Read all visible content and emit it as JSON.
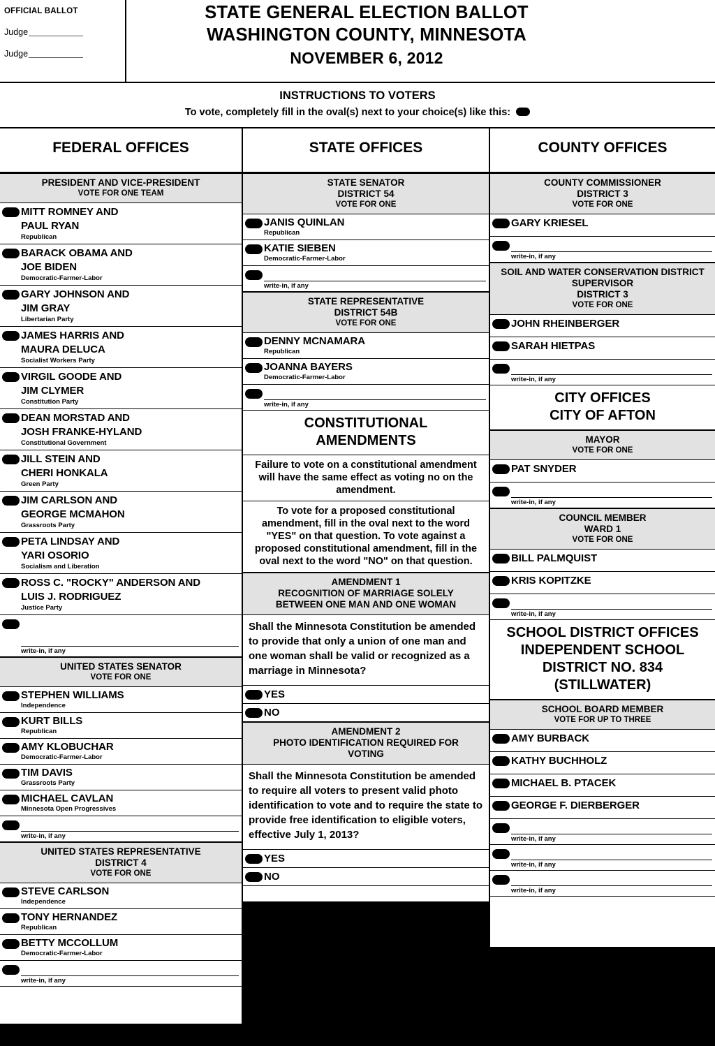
{
  "header": {
    "official_ballot": "OFFICIAL BALLOT",
    "judge_label_1": "Judge",
    "judge_label_2": "Judge",
    "title_line1": "STATE GENERAL ELECTION BALLOT",
    "title_line2": "WASHINGTON COUNTY, MINNESOTA",
    "title_line3": "NOVEMBER 6, 2012"
  },
  "instructions": {
    "heading": "INSTRUCTIONS TO VOTERS",
    "text": "To vote, completely fill in the oval(s) next to your choice(s) like this:"
  },
  "writein_label": "write-in, if any",
  "federal": {
    "column_title": "FEDERAL OFFICES",
    "contests": [
      {
        "office": "PRESIDENT AND VICE-PRESIDENT",
        "district": "",
        "vote_for": "VOTE FOR ONE TEAM",
        "candidates": [
          {
            "name1": "MITT ROMNEY AND",
            "name2": "PAUL RYAN",
            "party": "Republican"
          },
          {
            "name1": "BARACK OBAMA AND",
            "name2": "JOE BIDEN",
            "party": "Democratic-Farmer-Labor"
          },
          {
            "name1": "GARY JOHNSON AND",
            "name2": "JIM GRAY",
            "party": "Libertarian Party"
          },
          {
            "name1": "JAMES HARRIS AND",
            "name2": "MAURA DELUCA",
            "party": "Socialist Workers Party"
          },
          {
            "name1": "VIRGIL GOODE AND",
            "name2": "JIM CLYMER",
            "party": "Constitution Party"
          },
          {
            "name1": "DEAN MORSTAD AND",
            "name2": "JOSH FRANKE-HYLAND",
            "party": "Constitutional Government"
          },
          {
            "name1": "JILL STEIN AND",
            "name2": "CHERI HONKALA",
            "party": "Green Party"
          },
          {
            "name1": "JIM CARLSON AND",
            "name2": "GEORGE MCMAHON",
            "party": "Grassroots Party"
          },
          {
            "name1": "PETA LINDSAY AND",
            "name2": "YARI OSORIO",
            "party": "Socialism and Liberation"
          },
          {
            "name1": "ROSS C. \"ROCKY\" ANDERSON AND",
            "name2": "LUIS J. RODRIGUEZ",
            "party": "Justice Party"
          }
        ]
      },
      {
        "office": "UNITED  STATES SENATOR",
        "district": "",
        "vote_for": "VOTE FOR ONE",
        "candidates": [
          {
            "name1": "STEPHEN WILLIAMS",
            "name2": "",
            "party": "Independence"
          },
          {
            "name1": "KURT BILLS",
            "name2": "",
            "party": "Republican"
          },
          {
            "name1": "AMY KLOBUCHAR",
            "name2": "",
            "party": "Democratic-Farmer-Labor"
          },
          {
            "name1": "TIM DAVIS",
            "name2": "",
            "party": "Grassroots Party"
          },
          {
            "name1": "MICHAEL CAVLAN",
            "name2": "",
            "party": "Minnesota Open Progressives"
          }
        ]
      },
      {
        "office": "UNITED STATES REPRESENTATIVE",
        "district": "DISTRICT 4",
        "vote_for": "VOTE FOR ONE",
        "candidates": [
          {
            "name1": "STEVE CARLSON",
            "name2": "",
            "party": "Independence"
          },
          {
            "name1": "TONY HERNANDEZ",
            "name2": "",
            "party": "Republican"
          },
          {
            "name1": "BETTY MCCOLLUM",
            "name2": "",
            "party": "Democratic-Farmer-Labor"
          }
        ]
      }
    ]
  },
  "state": {
    "column_title": "STATE OFFICES",
    "contests": [
      {
        "office": "STATE SENATOR",
        "district": "DISTRICT 54",
        "vote_for": "VOTE FOR ONE",
        "candidates": [
          {
            "name1": "JANIS QUINLAN",
            "name2": "",
            "party": "Republican"
          },
          {
            "name1": "KATIE SIEBEN",
            "name2": "",
            "party": "Democratic-Farmer-Labor"
          }
        ]
      },
      {
        "office": "STATE REPRESENTATIVE",
        "district": "DISTRICT 54B",
        "vote_for": "VOTE FOR ONE",
        "candidates": [
          {
            "name1": "DENNY MCNAMARA",
            "name2": "",
            "party": "Republican"
          },
          {
            "name1": "JOANNA BAYERS",
            "name2": "",
            "party": "Democratic-Farmer-Labor"
          }
        ]
      }
    ],
    "amendments_title_line1": "CONSTITUTIONAL",
    "amendments_title_line2": "AMENDMENTS",
    "amendments_note1": "Failure to vote on a constitutional amendment will have the same effect as voting no on the amendment.",
    "amendments_note2": "To vote for a proposed constitutional amendment, fill in the oval next to the word \"YES\" on that question. To vote against a proposed constitutional amendment, fill in the oval next to the word \"NO\" on that question.",
    "amendments": [
      {
        "number": "AMENDMENT 1",
        "title_line1": "RECOGNITION OF MARRIAGE SOLELY",
        "title_line2": "BETWEEN ONE MAN AND ONE WOMAN",
        "question": "Shall the Minnesota Constitution be amended to provide that only a union of one man and one woman shall be valid or recognized as a marriage in Minnesota?",
        "yes_label": "YES",
        "no_label": "NO"
      },
      {
        "number": "AMENDMENT 2",
        "title_line1": "PHOTO IDENTIFICATION REQUIRED FOR",
        "title_line2": "VOTING",
        "question": "Shall the Minnesota Constitution be amended to require all voters to present valid photo identification to vote and to require the state to provide free identification to eligible voters, effective July 1, 2013?",
        "yes_label": "YES",
        "no_label": "NO"
      }
    ]
  },
  "county": {
    "column_title": "COUNTY OFFICES",
    "contests": [
      {
        "office": "COUNTY COMMISSIONER",
        "district": "DISTRICT 3",
        "vote_for": "VOTE FOR ONE",
        "candidates": [
          {
            "name1": "GARY KRIESEL",
            "name2": "",
            "party": ""
          }
        ]
      },
      {
        "office": "SOIL AND WATER CONSERVATION DISTRICT SUPERVISOR",
        "district": "DISTRICT 3",
        "vote_for": "VOTE FOR ONE",
        "candidates": [
          {
            "name1": "JOHN RHEINBERGER",
            "name2": "",
            "party": ""
          },
          {
            "name1": "SARAH HIETPAS",
            "name2": "",
            "party": ""
          }
        ]
      }
    ],
    "city_title_line1": "CITY OFFICES",
    "city_title_line2": "CITY OF AFTON",
    "city_contests": [
      {
        "office": "MAYOR",
        "district": "",
        "vote_for": "VOTE FOR ONE",
        "candidates": [
          {
            "name1": "PAT SNYDER",
            "name2": "",
            "party": ""
          }
        ]
      },
      {
        "office": "COUNCIL MEMBER",
        "district": "WARD 1",
        "vote_for": "VOTE FOR ONE",
        "candidates": [
          {
            "name1": "BILL PALMQUIST",
            "name2": "",
            "party": ""
          },
          {
            "name1": "KRIS KOPITZKE",
            "name2": "",
            "party": ""
          }
        ]
      }
    ],
    "school_title_line1": "SCHOOL DISTRICT OFFICES",
    "school_title_line2": "INDEPENDENT SCHOOL",
    "school_title_line3": "DISTRICT NO. 834",
    "school_title_line4": "(STILLWATER)",
    "school_contests": [
      {
        "office": "SCHOOL BOARD MEMBER",
        "district": "",
        "vote_for": "VOTE FOR UP TO THREE",
        "candidates": [
          {
            "name1": "AMY BURBACK",
            "name2": "",
            "party": ""
          },
          {
            "name1": "KATHY BUCHHOLZ",
            "name2": "",
            "party": ""
          },
          {
            "name1": "MICHAEL B. PTACEK",
            "name2": "",
            "party": ""
          },
          {
            "name1": "GEORGE F. DIERBERGER",
            "name2": "",
            "party": ""
          }
        ]
      }
    ]
  },
  "colors": {
    "paper": "#ffffff",
    "ink": "#000000",
    "band": "#e2e2e2",
    "void": "#000000"
  }
}
